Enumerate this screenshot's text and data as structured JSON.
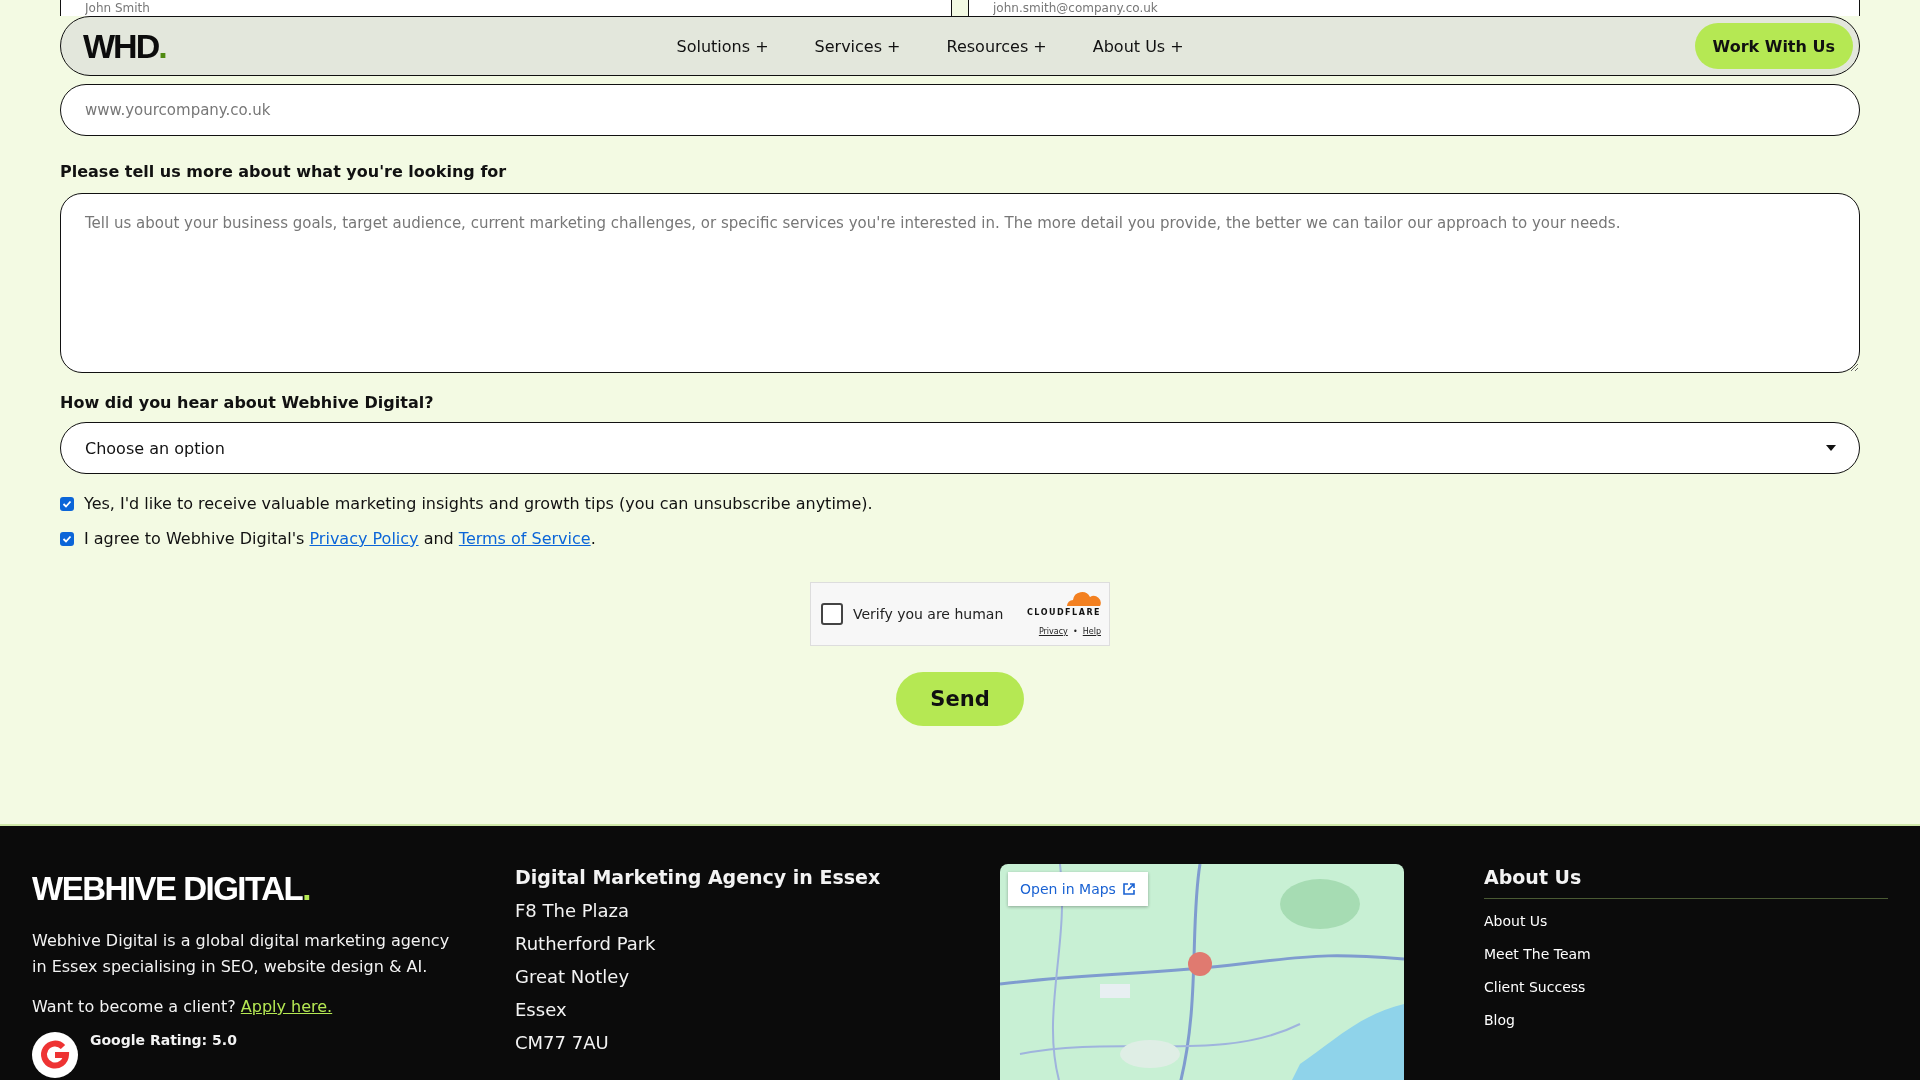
{
  "nav": {
    "logo": "WHD",
    "logo_dot": ".",
    "items": [
      "Solutions +",
      "Services +",
      "Resources +",
      "About Us +"
    ],
    "cta": "Work With Us"
  },
  "form": {
    "name_placeholder": "John Smith",
    "email_placeholder": "john.smith@company.co.uk",
    "website_placeholder": "www.yourcompany.co.uk",
    "details_label": "Please tell us more about what you're looking for",
    "details_placeholder": "Tell us about your business goals, target audience, current marketing challenges, or specific services you're interested in. The more detail you provide, the better we can tailor our approach to your needs.",
    "source_label": "How did you hear about Webhive Digital?",
    "source_value": "Choose an option",
    "consents": [
      {
        "text": "Yes, I'd like to receive valuable marketing insights and growth tips (you can unsubscribe anytime).",
        "checked": true
      },
      {
        "text": "I agree to Webhive Digital's ",
        "link1": "Privacy Policy",
        "middle": " and ",
        "link2": "Terms of Service",
        "end": ".",
        "checked": true
      }
    ],
    "captcha": {
      "label": "Verify you are human",
      "checked": false,
      "brand": "CLOUDFLARE",
      "privacy": "Privacy",
      "separator": "•",
      "help": "Help"
    },
    "submit": "Send"
  },
  "footer": {
    "logo": "WEBHIVE DIGITAL",
    "logo_dot": ".",
    "about": "Webhive Digital is a global digital marketing agency in Essex specialising in SEO, website design & AI.",
    "client_prompt": "Want to become a client?",
    "client_link": "Apply here.",
    "rating": "Google Rating: 5.0",
    "address_title": "Digital Marketing Agency in Essex",
    "address": [
      "F8 The Plaza",
      "Rutherford Park",
      "Great Notley",
      "Essex",
      "CM77 7AU"
    ],
    "map": {
      "kind": "picture",
      "open_button": "Open in Maps"
    },
    "links_title": "About Us",
    "links": [
      "About Us",
      "Meet The Team",
      "Client Success",
      "Blog"
    ]
  }
}
